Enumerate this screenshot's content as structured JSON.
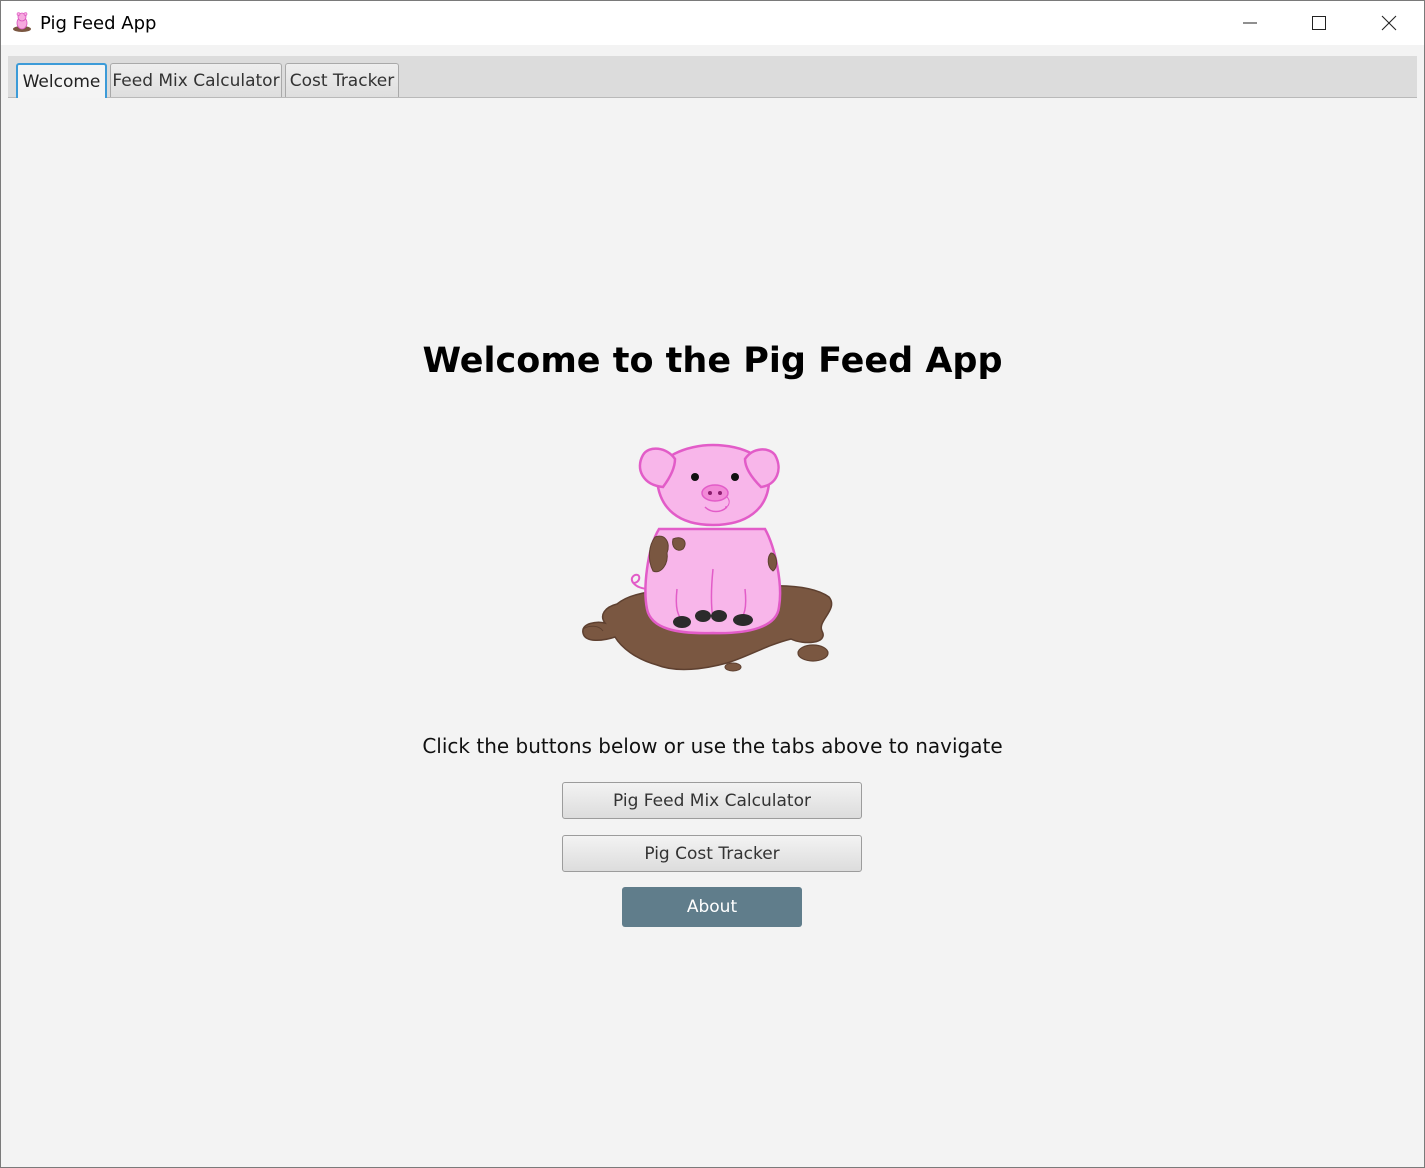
{
  "window": {
    "title": "Pig Feed App"
  },
  "tabs": [
    {
      "label": "Welcome",
      "active": true
    },
    {
      "label": "Feed Mix Calculator",
      "active": false
    },
    {
      "label": "Cost Tracker",
      "active": false
    }
  ],
  "welcome": {
    "heading": "Welcome to the Pig Feed App",
    "instruction": "Click the buttons below or use the tabs above to navigate",
    "buttons": {
      "feed_mix": "Pig Feed Mix Calculator",
      "cost_tracker": "Pig Cost Tracker",
      "about": "About"
    }
  },
  "colors": {
    "about_button": "#607d8b",
    "active_tab_border": "#3c9bd8",
    "pig_pink": "#f8b6ea",
    "mud_brown": "#7a5741"
  }
}
